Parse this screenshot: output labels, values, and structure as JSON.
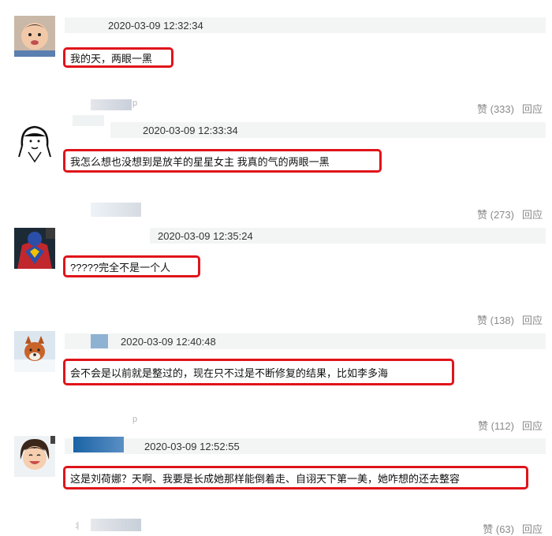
{
  "comments": [
    {
      "avatar": "toddler-avatar",
      "timestamp": "2020-03-09 12:32:34",
      "text": "我的天，两眼一黑",
      "likes": "赞 (333)",
      "reply": "回应",
      "username_hint": "p"
    },
    {
      "avatar": "drawn-girl-avatar",
      "timestamp": "2020-03-09 12:33:34",
      "text": "我怎么想也没想到是放羊的星星女主 我真的气的两眼一黑",
      "likes": "赞 (273)",
      "reply": "回应"
    },
    {
      "avatar": "superhero-avatar",
      "timestamp": "2020-03-09 12:35:24",
      "text": "?????完全不是一个人",
      "likes": "赞 (138)",
      "reply": "回应"
    },
    {
      "avatar": "fox-in-snow-avatar",
      "timestamp": "2020-03-09 12:40:48",
      "text": "会不会是以前就是整过的，现在只不过是不断修复的结果，比如李多海",
      "likes": "赞 (112)",
      "reply": "回应",
      "username_hint": "p"
    },
    {
      "avatar": "smiling-girl-avatar",
      "timestamp": "2020-03-09 12:52:55",
      "text": "这是刘荷娜？天啊、我要是长成她那样能倒着走、自诩天下第一美，她咋想的还去整容",
      "likes": "赞 (63)",
      "reply": "回应",
      "username_hint": "丬"
    }
  ]
}
